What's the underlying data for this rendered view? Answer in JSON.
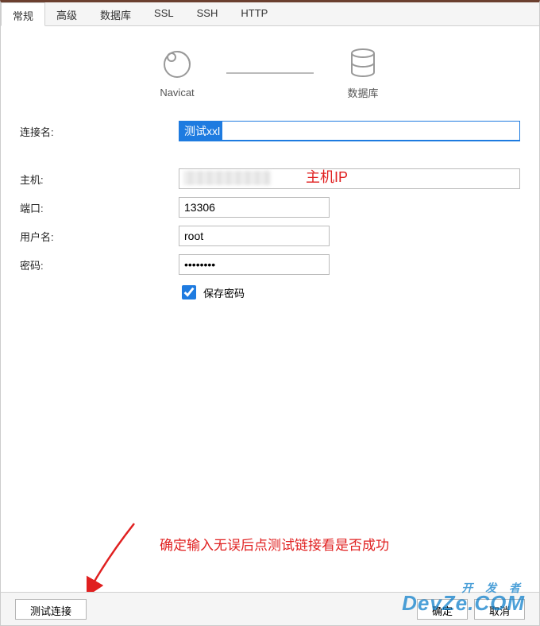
{
  "tabs": {
    "t0": "常规",
    "t1": "高级",
    "t2": "数据库",
    "t3": "SSL",
    "t4": "SSH",
    "t5": "HTTP"
  },
  "diagram": {
    "left": "Navicat",
    "right": "数据库"
  },
  "labels": {
    "conn_name": "连接名:",
    "host": "主机:",
    "port": "端口:",
    "user": "用户名:",
    "password": "密码:",
    "save_password": "保存密码"
  },
  "values": {
    "conn_name": "测试xxl",
    "host": "",
    "port": "13306",
    "user": "root",
    "password": "••••••••"
  },
  "annotations": {
    "host_ip": "主机IP",
    "instruction": "确定输入无误后点测试链接看是否成功"
  },
  "buttons": {
    "test": "测试连接",
    "ok": "确定",
    "cancel": "取消"
  },
  "watermark": {
    "top": "开 发 者",
    "main": "DevZe.COM"
  }
}
